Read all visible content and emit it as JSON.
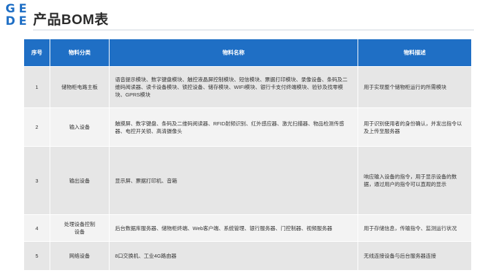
{
  "logo": {
    "letters": [
      "G",
      "E",
      "D",
      "E"
    ]
  },
  "page": {
    "title": "产品BOM表"
  },
  "table": {
    "headers": [
      "序号",
      "物料分类",
      "物料名称",
      "物料描述"
    ],
    "rows": [
      {
        "no": "1",
        "category": "储物柜电路主板",
        "name": "语音提示模块、数字键盘模块、触控液晶屏控制模块、短信模块、票据打印模块、录像设备、条码及二维码阅读器、读卡设备模块、锁控设备、储存模块、WIFI模块、银行卡支付终端模块、验钞及找零模块、GPRS模块",
        "desc": "用于实现整个储物柜运行的所需模块"
      },
      {
        "no": "2",
        "category": "输入设备",
        "name": "触摸屏、数字键盘、条码及二维码阅读器、RFID射频识别、红外感应器、激光扫描器、物品检测传感器、电控开关锁、高清摄像头",
        "desc": "用于识别使用者的身份确认，并发出指令以及上传至服务器"
      },
      {
        "no": "3",
        "category": "输出设备",
        "name": "显示屏、票据打印机、音箱",
        "desc": "响应输入设备的指令，用于显示设备的数据，通过用户的指令可以直观的显示"
      },
      {
        "no": "4",
        "category": "处理设备控制设备",
        "name": "后台数据库服务器、储物柜终端、Web客户端、系统管理、银行服务器、门控制器、视频服务器",
        "desc": "用于存储信息，传输指令、监测运行状况"
      },
      {
        "no": "5",
        "category": "网络设备",
        "name": "8口交换机、工业4G路由器",
        "desc": "无线连接设备与后台服务器连接"
      }
    ]
  }
}
